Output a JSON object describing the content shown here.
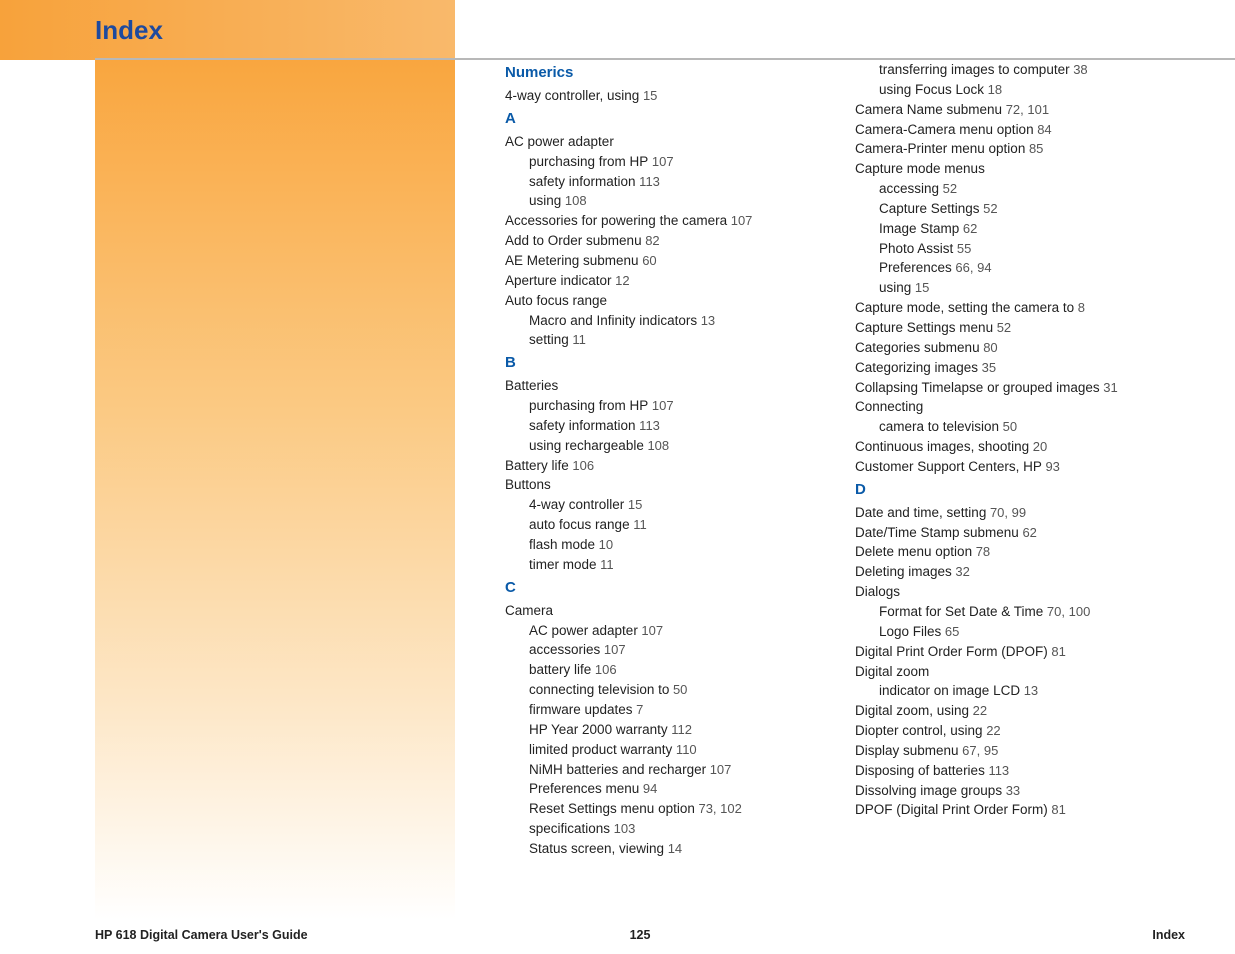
{
  "header": {
    "title": "Index"
  },
  "footer": {
    "left": "HP 618 Digital Camera User's Guide",
    "center": "125",
    "right": "Index"
  },
  "col1": [
    {
      "type": "letter",
      "text": "Numerics"
    },
    {
      "type": "entry",
      "text": "4-way controller, using",
      "pages": "15"
    },
    {
      "type": "letter",
      "text": "A"
    },
    {
      "type": "entry",
      "text": "AC power adapter"
    },
    {
      "type": "sub",
      "text": "purchasing from HP",
      "pages": "107"
    },
    {
      "type": "sub",
      "text": "safety information",
      "pages": "113"
    },
    {
      "type": "sub",
      "text": "using",
      "pages": "108"
    },
    {
      "type": "entry",
      "text": "Accessories for powering the camera",
      "pages": "107"
    },
    {
      "type": "entry",
      "text": "Add to Order submenu",
      "pages": "82"
    },
    {
      "type": "entry",
      "text": "AE Metering submenu",
      "pages": "60"
    },
    {
      "type": "entry",
      "text": "Aperture indicator",
      "pages": "12"
    },
    {
      "type": "entry",
      "text": "Auto focus range"
    },
    {
      "type": "sub",
      "text": "Macro and Infinity indicators",
      "pages": "13"
    },
    {
      "type": "sub",
      "text": "setting",
      "pages": "11"
    },
    {
      "type": "letter",
      "text": "B"
    },
    {
      "type": "entry",
      "text": "Batteries"
    },
    {
      "type": "sub",
      "text": "purchasing from HP",
      "pages": "107"
    },
    {
      "type": "sub",
      "text": "safety information",
      "pages": "113"
    },
    {
      "type": "sub",
      "text": "using rechargeable",
      "pages": "108"
    },
    {
      "type": "entry",
      "text": "Battery life",
      "pages": "106"
    },
    {
      "type": "entry",
      "text": "Buttons"
    },
    {
      "type": "sub",
      "text": "4-way controller",
      "pages": "15"
    },
    {
      "type": "sub",
      "text": "auto focus range",
      "pages": "11"
    },
    {
      "type": "sub",
      "text": "flash mode",
      "pages": "10"
    },
    {
      "type": "sub",
      "text": "timer mode",
      "pages": "11"
    },
    {
      "type": "letter",
      "text": "C"
    },
    {
      "type": "entry",
      "text": "Camera"
    },
    {
      "type": "sub",
      "text": "AC power adapter",
      "pages": "107"
    },
    {
      "type": "sub",
      "text": "accessories",
      "pages": "107"
    },
    {
      "type": "sub",
      "text": "battery life",
      "pages": "106"
    },
    {
      "type": "sub",
      "text": "connecting television to",
      "pages": "50"
    },
    {
      "type": "sub",
      "text": "firmware updates",
      "pages": "7"
    },
    {
      "type": "sub",
      "text": "HP Year 2000 warranty",
      "pages": "112"
    },
    {
      "type": "sub",
      "text": "limited product warranty",
      "pages": "110"
    },
    {
      "type": "sub",
      "text": "NiMH batteries and recharger",
      "pages": "107"
    },
    {
      "type": "sub",
      "text": "Preferences menu",
      "pages": "94"
    },
    {
      "type": "sub",
      "text": "Reset Settings menu option",
      "pages": "73, 102"
    },
    {
      "type": "sub",
      "text": "specifications",
      "pages": "103"
    },
    {
      "type": "sub",
      "text": "Status screen, viewing",
      "pages": "14"
    }
  ],
  "col2": [
    {
      "type": "sub",
      "text": "transferring images to computer",
      "pages": "38"
    },
    {
      "type": "sub",
      "text": "using Focus Lock",
      "pages": "18"
    },
    {
      "type": "entry",
      "text": "Camera Name submenu",
      "pages": "72, 101"
    },
    {
      "type": "entry",
      "text": "Camera-Camera menu option",
      "pages": "84"
    },
    {
      "type": "entry",
      "text": "Camera-Printer menu option",
      "pages": "85"
    },
    {
      "type": "entry",
      "text": "Capture mode menus"
    },
    {
      "type": "sub",
      "text": "accessing",
      "pages": "52"
    },
    {
      "type": "sub",
      "text": "Capture Settings",
      "pages": "52"
    },
    {
      "type": "sub",
      "text": "Image Stamp",
      "pages": "62"
    },
    {
      "type": "sub",
      "text": "Photo Assist",
      "pages": "55"
    },
    {
      "type": "sub",
      "text": "Preferences",
      "pages": "66, 94"
    },
    {
      "type": "sub",
      "text": "using",
      "pages": "15"
    },
    {
      "type": "entry",
      "text": "Capture mode, setting the camera to",
      "pages": "8"
    },
    {
      "type": "entry",
      "text": "Capture Settings menu",
      "pages": "52"
    },
    {
      "type": "entry",
      "text": "Categories submenu",
      "pages": "80"
    },
    {
      "type": "entry",
      "text": "Categorizing images",
      "pages": "35"
    },
    {
      "type": "entry",
      "text": "Collapsing Timelapse or grouped images",
      "pages": "31"
    },
    {
      "type": "entry",
      "text": "Connecting"
    },
    {
      "type": "sub",
      "text": "camera to television",
      "pages": "50"
    },
    {
      "type": "entry",
      "text": "Continuous images, shooting",
      "pages": "20"
    },
    {
      "type": "entry",
      "text": "Customer Support Centers, HP",
      "pages": "93"
    },
    {
      "type": "letter",
      "text": "D"
    },
    {
      "type": "entry",
      "text": "Date and time, setting",
      "pages": "70, 99"
    },
    {
      "type": "entry",
      "text": "Date/Time Stamp submenu",
      "pages": "62"
    },
    {
      "type": "entry",
      "text": "Delete menu option",
      "pages": "78"
    },
    {
      "type": "entry",
      "text": "Deleting images",
      "pages": "32"
    },
    {
      "type": "entry",
      "text": "Dialogs"
    },
    {
      "type": "sub",
      "text": "Format for Set Date & Time",
      "pages": "70, 100"
    },
    {
      "type": "sub",
      "text": "Logo Files",
      "pages": "65"
    },
    {
      "type": "entry",
      "text": "Digital Print Order Form (DPOF)",
      "pages": "81"
    },
    {
      "type": "entry",
      "text": "Digital zoom"
    },
    {
      "type": "sub",
      "text": "indicator on image LCD",
      "pages": "13"
    },
    {
      "type": "entry",
      "text": "Digital zoom, using",
      "pages": "22"
    },
    {
      "type": "entry",
      "text": "Diopter control, using",
      "pages": "22"
    },
    {
      "type": "entry",
      "text": "Display submenu",
      "pages": "67, 95"
    },
    {
      "type": "entry",
      "text": "Disposing of batteries",
      "pages": "113"
    },
    {
      "type": "entry",
      "text": "Dissolving image groups",
      "pages": "33"
    },
    {
      "type": "entry",
      "text": "DPOF (Digital Print Order Form)",
      "pages": "81"
    }
  ]
}
